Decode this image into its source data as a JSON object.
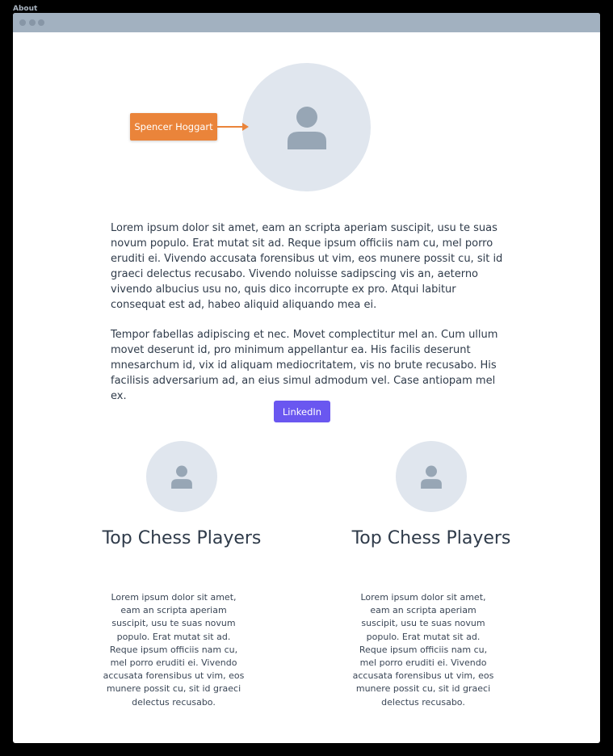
{
  "tab": {
    "title": "About"
  },
  "profile": {
    "name": "Spencer Hoggart",
    "avatar_icon": "user-icon",
    "bio_paragraph_1": "Lorem ipsum dolor sit amet, eam an scripta aperiam suscipit, usu te suas novum populo. Erat mutat sit ad. Reque ipsum officiis nam cu, mel porro eruditi ei. Vivendo accusata forensibus ut vim, eos munere possit cu, sit id graeci delectus recusabo. Vivendo noluisse sadipscing vis an, aeterno vivendo albucius usu no, quis dico incorrupte ex pro. Atqui labitur consequat est ad, habeo aliquid aliquando mea ei.",
    "bio_paragraph_2": "Tempor fabellas adipiscing et nec. Movet complectitur mel an. Cum ullum movet deserunt id, pro minimum appellantur ea. His facilis deserunt mnesarchum id, vix id aliquam mediocritatem, vis no brute recusabo. His facilisis adversarium ad, an eius simul admodum vel. Case antiopam mel ex.",
    "linkedin_label": "LinkedIn"
  },
  "columns": [
    {
      "title": "Top Chess Players",
      "text": "Lorem ipsum dolor sit amet, eam an scripta aperiam suscipit, usu te suas novum populo. Erat mutat sit ad. Reque ipsum officiis nam cu, mel porro eruditi ei. Vivendo accusata forensibus ut vim, eos munere possit cu, sit id graeci delectus recusabo."
    },
    {
      "title": "Top Chess Players",
      "text": "Lorem ipsum dolor sit amet, eam an scripta aperiam suscipit, usu te suas novum populo. Erat mutat sit ad. Reque ipsum officiis nam cu, mel porro eruditi ei. Vivendo accusata forensibus ut vim, eos munere possit cu, sit id graeci delectus recusabo."
    }
  ],
  "colors": {
    "accent_orange": "#ea843a",
    "button_purple": "#6a57f0",
    "avatar_bg": "#e0e6ee",
    "avatar_icon": "#97a6b5",
    "titlebar": "#a2b1c0"
  }
}
